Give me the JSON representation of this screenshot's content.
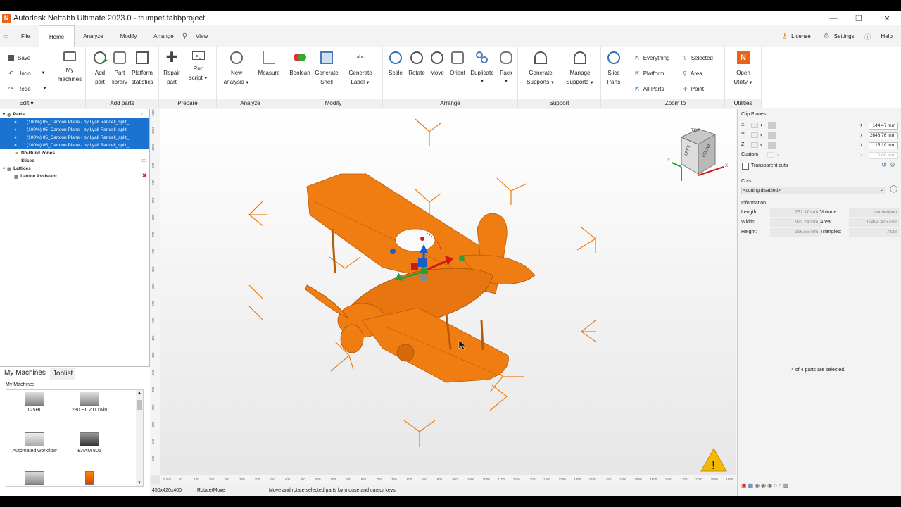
{
  "window": {
    "title": "Autodesk Netfabb Ultimate 2023.0 - trumpet.fabbproject",
    "logo": "N"
  },
  "menu": {
    "tabs": [
      "File",
      "Home",
      "Analyze",
      "Modify",
      "Arrange",
      "View"
    ],
    "right": {
      "license": "License",
      "settings": "Settings",
      "help": "Help"
    }
  },
  "ribbon": {
    "edit": {
      "save": "Save",
      "undo": "Undo",
      "redo": "Redo",
      "label": "Edit"
    },
    "machines": {
      "l1": "My",
      "l2": "machines"
    },
    "add_parts": {
      "add1": "Add",
      "add2": "part",
      "lib1": "Part",
      "lib2": "library",
      "stat1": "Platform",
      "stat2": "statistics",
      "label": "Add parts"
    },
    "prepare": {
      "repair1": "Repair",
      "repair2": "part",
      "run1": "Run",
      "run2": "script",
      "label": "Prepare"
    },
    "analyze": {
      "new1": "New",
      "new2": "analysis",
      "measure": "Measure",
      "label": "Analyze"
    },
    "modify": {
      "boolean": "Boolean",
      "shell1": "Generate",
      "shell2": "Shell",
      "label1": "Generate",
      "label2": "Label",
      "label": "Modify"
    },
    "arrange": {
      "scale": "Scale",
      "rotate": "Rotate",
      "move": "Move",
      "orient": "Orient",
      "duplicate": "Duplicate",
      "pack": "Pack",
      "label": "Arrange"
    },
    "support": {
      "gen1": "Generate",
      "gen2": "Supports",
      "man1": "Manage",
      "man2": "Supports",
      "label": "Support"
    },
    "slice": {
      "l1": "Slice",
      "l2": "Parts"
    },
    "zoom": {
      "everything": "Everything",
      "platform": "Platform",
      "all_parts": "All Parts",
      "selected": "Selected",
      "area": "Area",
      "point": "Point",
      "label": "Zoom to"
    },
    "utilities": {
      "open1": "Open",
      "open2": "Utility",
      "label": "Utilities"
    }
  },
  "tree": {
    "parts": "Parts",
    "items": [
      "(100%) 05_Cartoon Plane - by Lyall Randell_split_",
      "(100%) 05_Cartoon Plane - by Lyall Randell_split_",
      "(100%) 05_Cartoon Plane - by Lyall Randell_split_",
      "(100%) 05_Cartoon Plane - by Lyall Randell_split_"
    ],
    "nobuild": "No-Build Zones",
    "slices": "Slices",
    "lattices": "Lattices",
    "lattice_assistant": "Lattice Assistant"
  },
  "machines_panel": {
    "tabs": [
      "My Machines",
      "Joblist"
    ],
    "header": "My Machines",
    "items": [
      "125HL",
      "280 HL 2.0 Twin",
      "Automated workflow",
      "BAAM 806"
    ]
  },
  "viewcube": {
    "top": "TOP",
    "left": "LEFT",
    "front": "FRONT",
    "y": "Y",
    "x": "X"
  },
  "ruler": {
    "horizontal": [
      "0 mm",
      "50",
      "100",
      "150",
      "200",
      "250",
      "300",
      "350",
      "400",
      "450",
      "500",
      "550",
      "600",
      "650",
      "700",
      "750",
      "800",
      "850",
      "900",
      "950",
      "1000",
      "1050",
      "1100",
      "1150",
      "1200",
      "1250",
      "1300",
      "1350",
      "1400",
      "1450",
      "1500",
      "1550",
      "1600",
      "1650",
      "1700",
      "1750",
      "1800",
      "1850"
    ],
    "vertical": [
      "1100",
      "1050",
      "1000",
      "950",
      "900",
      "850",
      "800",
      "750",
      "700",
      "650",
      "600",
      "550",
      "500",
      "450",
      "400",
      "350",
      "300",
      "250",
      "200",
      "150",
      "100"
    ]
  },
  "status": {
    "dims": "450x420x400",
    "mode": "Rotate/Move",
    "hint": "Move and rotate selected parts by mouse and cursor keys."
  },
  "right": {
    "clip_planes": "Clip Planes",
    "x_label": "X:",
    "x_val": "144.47 mm",
    "y_label": "Y:",
    "y_val": "2648.76 mm",
    "z_label": "Z:",
    "z_val": "15.19 mm",
    "custom_label": "Custom",
    "custom_val": "0.00 mm",
    "transparent": "Transparent cuts",
    "cuts": "Cuts",
    "cuts_select": "<cutting disabled>",
    "information": "Information",
    "length_label": "Length:",
    "length_val": "752.37 mm",
    "width_label": "Width:",
    "width_val": "922.24 mm",
    "height_label": "Height:",
    "height_val": "396.55 mm",
    "volume_label": "Volume:",
    "volume_val": "Not defined",
    "area_label": "Area:",
    "area_val": "12494.425 cm²",
    "triangles_label": "Triangles:",
    "triangles_val": "7828",
    "selection": "4 of 4 parts are selected."
  },
  "colors": {
    "accent": "#1a73d0",
    "part": "#ef7d12",
    "logo": "#e8641b"
  }
}
